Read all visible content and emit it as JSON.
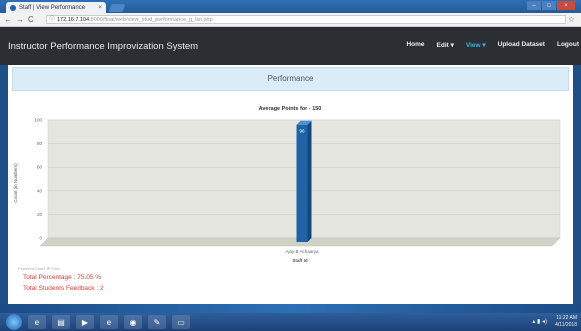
{
  "browser": {
    "tab_title": "Staff | View Performance",
    "tab_close": "×",
    "url_host": "172.16.7.104",
    "url_path": ":8000/final/web/view_stud_performance_g_list.php",
    "back": "←",
    "forward": "→",
    "reload": "C",
    "lock": "ⓘ",
    "star": "☆"
  },
  "navbar": {
    "brand": "Instructor Performance Improvization System",
    "items": [
      {
        "label": "Home"
      },
      {
        "label": "Edit ▾"
      },
      {
        "label": "View ▾"
      },
      {
        "label": "Upload Dataset"
      },
      {
        "label": "Logout"
      }
    ]
  },
  "panel": {
    "heading": "Performance"
  },
  "chart_data": {
    "type": "bar",
    "title": "Average Points for - 150",
    "categories": [
      "Ajay B Achaarya"
    ],
    "values": [
      96
    ],
    "data_labels": [
      "96"
    ],
    "xlabel": "Staff Id",
    "ylabel": "Count (in Numbers)",
    "ylim": [
      0,
      100
    ],
    "yticks": [
      "0",
      "20",
      "40",
      "60",
      "80",
      "100"
    ],
    "grid": true,
    "colors": {
      "bar": "#1f63a6",
      "bar_light": "#4a90d2",
      "plot_bg": "#e4e6df"
    }
  },
  "footer": {
    "note": "Powered Chart JP Free",
    "total_percentage": "Total Percentage : 75.05 %",
    "total_feedback": "Total Students Feedback : 2"
  },
  "taskbar": {
    "time": "11:22 AM",
    "date": "4/11/2018",
    "icons": [
      "ie-icon",
      "folder-icon",
      "media-icon",
      "explorer-icon",
      "chrome-icon",
      "paint-icon",
      "window-icon"
    ]
  }
}
